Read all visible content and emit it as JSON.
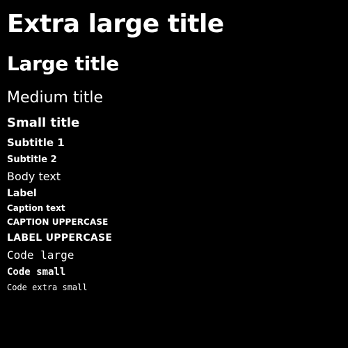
{
  "theme": {
    "background": "#000000",
    "text": "#ffffff"
  },
  "typography": {
    "extra_large_title": "Extra large title",
    "large_title": "Large title",
    "medium_title": "Medium title",
    "small_title": "Small title",
    "subtitle_1": "Subtitle 1",
    "subtitle_2": "Subtitle 2",
    "body_text": "Body text",
    "label": "Label",
    "caption_text": "Caption text",
    "caption_uppercase": "CAPTION UPPERCASE",
    "label_uppercase": "LABEL UPPERCASE",
    "code_large": "Code large",
    "code_small": "Code small",
    "code_extra_small": "Code extra small"
  }
}
